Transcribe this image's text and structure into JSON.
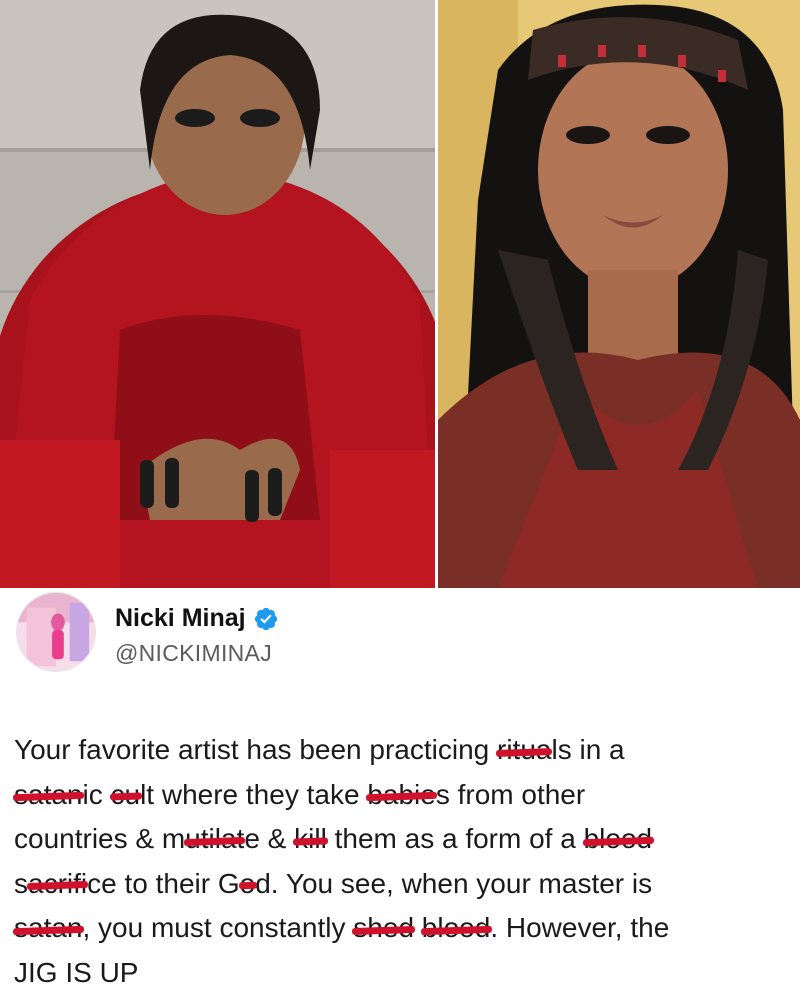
{
  "images": {
    "left_photo_alt": "",
    "right_photo_alt": ""
  },
  "tweet": {
    "display_name": "Nicki Minaj",
    "handle": "@NICKIMINAJ",
    "verified_icon": "verified-badge-icon",
    "body": {
      "l1a": "Your favorite artist has been practicing ",
      "l1b": "ritua",
      "l1c": "ls in a",
      "l2a": "satan",
      "l2b": "ic ",
      "l2c": "cu",
      "l2d": "lt where they take ",
      "l2e": "babie",
      "l2f": "s from other",
      "l3a": "countries & m",
      "l3b": "utilat",
      "l3c": "e & ",
      "l3d": "kill",
      "l3e": " them as a form of a ",
      "l3f": "blood",
      "l4a": "s",
      "l4b": "acrifi",
      "l4c": "ce to their G",
      "l4d": "o",
      "l4e": "d. You see, when your master is",
      "l5a": "satan",
      "l5b": ", you must constantly ",
      "l5c": "shed",
      "l5d": " ",
      "l5e": "blood",
      "l5f": ". However, the",
      "l6": "JIG IS UP"
    }
  },
  "colors": {
    "strike": "#d0112b",
    "verified": "#1d9bf0"
  }
}
